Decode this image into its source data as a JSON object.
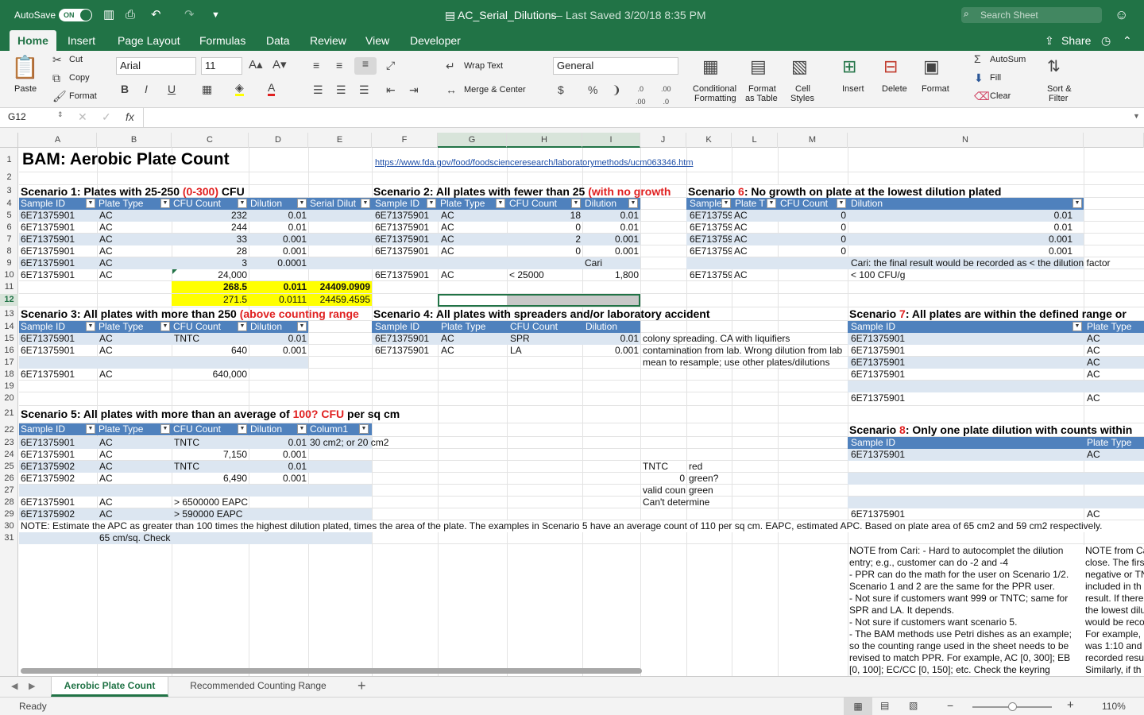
{
  "app": {
    "autosave_label": "AutoSave",
    "autosave_state": "ON",
    "doc_title": "AC_Serial_Dilutions",
    "saved": "— Last Saved 3/20/18 8:35 PM",
    "search_placeholder": "Search Sheet",
    "share": "Share",
    "accent": "#217346"
  },
  "tabs": [
    "Home",
    "Insert",
    "Page Layout",
    "Formulas",
    "Data",
    "Review",
    "View",
    "Developer"
  ],
  "ribbon": {
    "paste": "Paste",
    "cut": "Cut",
    "copy": "Copy",
    "format": "Format",
    "font": "Arial",
    "size": "11",
    "wrap": "Wrap Text",
    "merge": "Merge & Center",
    "numfmt": "General",
    "cond1": "Conditional",
    "cond2": "Formatting",
    "fat1": "Format",
    "fat2": "as Table",
    "cs1": "Cell",
    "cs2": "Styles",
    "insert": "Insert",
    "delete": "Delete",
    "formatcells": "Format",
    "autosum": "AutoSum",
    "fill": "Fill",
    "clear": "Clear",
    "sort1": "Sort &",
    "sort2": "Filter"
  },
  "formula": {
    "namebox": "G12",
    "fx": "fx"
  },
  "cols": [
    "A",
    "B",
    "C",
    "D",
    "E",
    "F",
    "G",
    "H",
    "I",
    "J",
    "K",
    "L",
    "M",
    "N"
  ],
  "rows": [
    "1",
    "2",
    "3",
    "4",
    "5",
    "6",
    "7",
    "8",
    "9",
    "10",
    "11",
    "12",
    "13",
    "14",
    "15",
    "16",
    "17",
    "18",
    "19",
    "20",
    "21",
    "22",
    "23",
    "24",
    "25",
    "26",
    "27",
    "28",
    "29",
    "30",
    "31"
  ],
  "sheet": {
    "title": "BAM: Aerobic Plate Count",
    "url": "https://www.fda.gov/food/foodscienceresearch/laboratorymethods/ucm063346.htm",
    "s1": {
      "a": "Scenario 1: Plates with 25-250 ",
      "b": "(0-300)",
      "c": " CFU"
    },
    "s2": {
      "a": "Scenario 2: All plates with fewer than 25 ",
      "b": "(with no growth"
    },
    "s6": {
      "a": "Scenario ",
      "b": "6",
      "c": ": No growth on plate at the lowest dilution plated"
    },
    "s3": {
      "a": "Scenario 3: All plates with more than 250 ",
      "b": "(above counting range"
    },
    "s4": "Scenario 4: All plates with spreaders and/or laboratory accident",
    "s7": {
      "a": "Scenario ",
      "b": "7",
      "c": ": All plates are within the defined range or"
    },
    "s5": {
      "a": "Scenario 5: All plates with more than an average of ",
      "b": "100? CFU",
      "c": " per sq cm"
    },
    "s8": {
      "a": "Scenario ",
      "b": "8",
      "c": ": Only one plate dilution with counts within"
    },
    "h": {
      "sid": "Sample ID",
      "pt": "Plate Type",
      "cfu": "CFU Count",
      "dil": "Dilution",
      "sd": "Serial Dilut",
      "samp": "Sample",
      "ptt": "Plate T",
      "col1": "Column1"
    },
    "id1": "6E71375901",
    "id2": "6E71375902",
    "idk": "6E71375901",
    "ac": "AC",
    "t1": {
      "c": [
        "232",
        "244",
        "33",
        "28",
        "3",
        "24,000"
      ],
      "d": [
        "0.01",
        "0.01",
        "0.001",
        "0.001",
        "0.0001"
      ]
    },
    "y11": [
      "268.5",
      "0.011",
      "24409.0909"
    ],
    "y12": [
      "271.5",
      "0.0111",
      "24459.4595"
    ],
    "t2": {
      "c": [
        "18",
        "0",
        "2",
        "0"
      ],
      "d": [
        "0.01",
        "0.01",
        "0.001",
        "0.001"
      ],
      "cari": "Cari",
      "c10": "< 25000",
      "d10": "1,800"
    },
    "t6": {
      "c": [
        "0",
        "0",
        "0",
        "0"
      ],
      "d": [
        "0.01",
        "0.01",
        "0.001",
        "0.001"
      ],
      "note": "Cari: the final result would be recorded as < the dilution factor",
      "res": "< 100 CFU/g"
    },
    "t3": {
      "c15": "TNTC",
      "d15": "0.01",
      "c16": "640",
      "d16": "0.001",
      "c18": "640,000"
    },
    "t4": {
      "c": [
        "SPR",
        "LA"
      ],
      "d": [
        "0.01",
        "0.001"
      ],
      "n": [
        "colony spreading. CA with liquifiers",
        "contamination from lab. Wrong dilution from lab",
        "mean to resample; use other plates/dilutions"
      ]
    },
    "t5": {
      "c": [
        "TNTC",
        "7,150",
        "TNTC",
        "6,490"
      ],
      "d": [
        "0.01",
        "0.001",
        "0.01",
        "0.001"
      ],
      "e23": "30 cm2; or 20 cm2",
      "c28": "> 6500000 EAPC",
      "c29": "> 590000 EAPC"
    },
    "legend": {
      "tntc": "TNTC",
      "red": "red",
      "zero": "0",
      "green": "green?",
      "valid": "valid coun",
      "green2": "green",
      "cant": "Can't determine"
    },
    "note30": "NOTE: Estimate the APC as greater than 100 times the highest dilution plated, times the area of the plate. The examples in Scenario 5 have an average count of 110 per sq cm. EAPC, estimated APC.  Based on plate area of 65 cm2 and 59 cm2 respectively.",
    "c31": "65 cm/sq. Check",
    "noteN": [
      "NOTE from Cari: - Hard to autocomplet the dilution",
      "entry; e.g., customer can do -2 and -4",
      "- PPR can do the math for the user on Scenario 1/2.",
      "Scenario 1 and 2 are the same for the PPR user.",
      "- Not sure if customers want 999 or TNTC; same for",
      "SPR and LA. It depends.",
      "- Not sure if customers want scenario 5.",
      "- The BAM methods use Petri dishes as an example;",
      "so the counting range used in the sheet needs to be",
      "revised to match PPR. For example, AC [0, 300]; EB",
      "[0, 100]; EC/CC [0, 150]; etc. Check the keyring"
    ],
    "noteO": [
      "NOTE from Ca",
      "close. The firs",
      "negative or TN",
      "included in th",
      "result. If there",
      "the lowest dilu",
      "would be reco",
      "For example,",
      "was 1:10 and",
      "recorded resu",
      "Similarly, if th"
    ]
  },
  "sheets": [
    "Aerobic Plate Count",
    "Recommended Counting Range"
  ],
  "status": {
    "ready": "Ready",
    "zoom": "110%"
  }
}
